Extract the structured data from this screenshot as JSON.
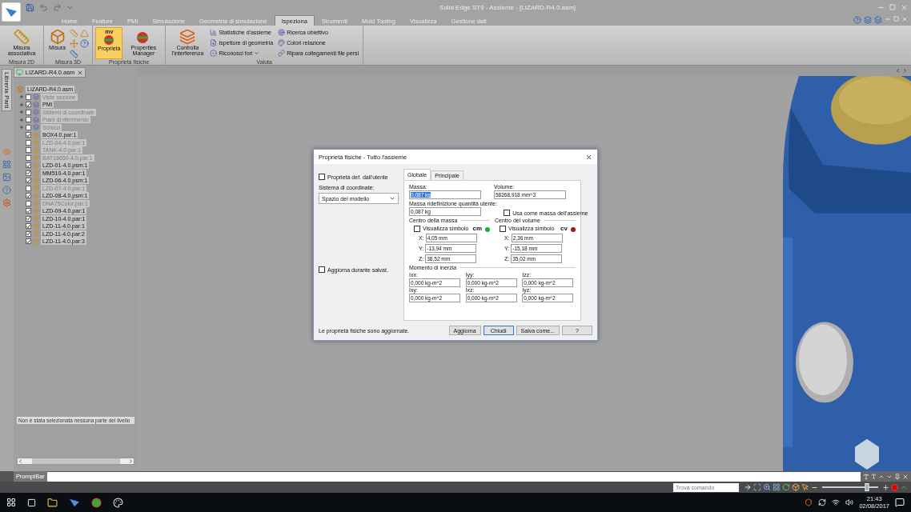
{
  "app": {
    "title": "Solid Edge ST9 - Assieme - [LIZARD-R4.0.asm]"
  },
  "ribbon_tabs": [
    {
      "label": "Home",
      "selected": false
    },
    {
      "label": "Feature",
      "selected": false
    },
    {
      "label": "PMI",
      "selected": false
    },
    {
      "label": "Simulazione",
      "selected": false
    },
    {
      "label": "Geometria di simulazione",
      "selected": false
    },
    {
      "label": "Ispeziona",
      "selected": true
    },
    {
      "label": "Strumenti",
      "selected": false
    },
    {
      "label": "Mold Tooling",
      "selected": false
    },
    {
      "label": "Visualizza",
      "selected": false
    },
    {
      "label": "Gestione dati",
      "selected": false
    }
  ],
  "ribbon_groups": [
    {
      "title": "Misura 2D",
      "items": [
        {
          "kind": "large",
          "label": "Misura associativa",
          "selected": false
        }
      ]
    },
    {
      "title": "Misura 3D",
      "items": [
        {
          "kind": "large",
          "label": "Misura",
          "selected": false
        },
        {
          "kind": "icons"
        }
      ]
    },
    {
      "title": "Proprietà fisiche",
      "items": [
        {
          "kind": "large",
          "label": "Proprietà",
          "badge": "mv",
          "selected": true
        },
        {
          "kind": "large",
          "label": "Properties Manager",
          "selected": false
        }
      ]
    },
    {
      "title": "Valuta",
      "items": [
        {
          "kind": "large",
          "label": "Controlla l'interferenza",
          "selected": false
        },
        {
          "kind": "stack",
          "entries": [
            {
              "label": "Statistiche d'assieme",
              "menu": false
            },
            {
              "label": "Ispettore di geometria",
              "menu": false
            },
            {
              "label": "Riconosci fori",
              "menu": true
            }
          ]
        },
        {
          "kind": "stack",
          "entries": [
            {
              "label": "Ricerca obiettivo",
              "menu": false
            },
            {
              "label": "Colori relazione",
              "menu": false
            },
            {
              "label": "Ripara collegamenti file persi",
              "menu": false
            }
          ]
        }
      ]
    }
  ],
  "side_tab": "Libreria Parti",
  "document_tab": "LIZARD-R4.0.asm",
  "tree": {
    "label": "LIZARD-R4.0.asm",
    "children": [
      {
        "kind": "group",
        "label": "Viste sezione",
        "checked": false,
        "expanded": false
      },
      {
        "kind": "group",
        "label": "PMI",
        "checked": true,
        "expanded": false
      },
      {
        "kind": "group",
        "label": "Sistemi di coordinate",
        "checked": false,
        "expanded": false
      },
      {
        "kind": "group",
        "label": "Piani di riferimento",
        "checked": false,
        "expanded": false
      },
      {
        "kind": "group",
        "label": "Schizzi",
        "checked": false,
        "expanded": false
      },
      {
        "kind": "part",
        "label": "BOX4.0.par:1",
        "checked": true
      },
      {
        "kind": "part",
        "label": "LZD-04-4.0.par:1",
        "checked": false
      },
      {
        "kind": "part",
        "label": "TANK-4.0.par:1",
        "checked": false
      },
      {
        "kind": "part",
        "label": "BAT18650-4.0.par:1",
        "checked": false
      },
      {
        "kind": "part",
        "label": "LZD-01-4.0.psm:1",
        "checked": true
      },
      {
        "kind": "part",
        "label": "MM510-4.0.par:1",
        "checked": true
      },
      {
        "kind": "part",
        "label": "LZD-06-4.0.psm:1",
        "checked": true
      },
      {
        "kind": "part",
        "label": "LZD-07-4.0.par:1",
        "checked": false
      },
      {
        "kind": "part",
        "label": "LZD-08-4.0.psm:1",
        "checked": true
      },
      {
        "kind": "part",
        "label": "DNA75Color.par:1",
        "checked": false
      },
      {
        "kind": "part",
        "label": "LZD-09-4.0.par:1",
        "checked": true
      },
      {
        "kind": "part",
        "label": "LZD-10-4.0.par:1",
        "checked": true
      },
      {
        "kind": "part",
        "label": "LZD-11-4.0.par:1",
        "checked": true
      },
      {
        "kind": "part",
        "label": "LZD-11-4.0.par:2",
        "checked": true
      },
      {
        "kind": "part",
        "label": "LZD-11-4.0.par:3",
        "checked": true
      }
    ]
  },
  "selection_message": "Non è stata selezionata nessuna parte del livello",
  "dialog": {
    "title": "Proprietà fisiche - Tutto l'assieme",
    "user_defined": {
      "label": "Proprietà def. dall'utente",
      "checked": false
    },
    "coord_label": "Sistema di coordinate:",
    "coord_value": "Spazio del modello",
    "update_on_save": {
      "label": "Aggiorna durante salvat.",
      "checked": false
    },
    "tabs": [
      {
        "label": "Globale",
        "selected": true
      },
      {
        "label": "Principale",
        "selected": false
      }
    ],
    "mass": {
      "label": "Massa:",
      "value": "0,087 kg",
      "selected": true
    },
    "volume": {
      "label": "Volume:",
      "value": "58268,918 mm^3"
    },
    "override": {
      "label": "Massa ridefinizione quantità utente:",
      "value": "0,087 kg"
    },
    "use_as_mass": {
      "label": "Usa come massa dell'assieme",
      "checked": false
    },
    "centers": [
      {
        "title": "Centro della massa",
        "show": {
          "label": "Visualizza simbolo",
          "checked": false
        },
        "symbol": "cm",
        "color": "#22aa33",
        "coords": [
          {
            "axis": "X:",
            "value": "4,05 mm"
          },
          {
            "axis": "Y:",
            "value": "-13,94 mm"
          },
          {
            "axis": "Z:",
            "value": "38,52 mm"
          }
        ]
      },
      {
        "title": "Centro del volume",
        "show": {
          "label": "Visualizza simbolo",
          "checked": false
        },
        "symbol": "cv",
        "color": "#aa1111",
        "coords": [
          {
            "axis": "X:",
            "value": "2,36 mm"
          },
          {
            "axis": "Y:",
            "value": "-15,18 mm"
          },
          {
            "axis": "Z:",
            "value": "35,02 mm"
          }
        ]
      }
    ],
    "inertia": {
      "title": "Momento di inerzia",
      "fields": [
        {
          "label": "Ixx:",
          "value": "0,000 kg-m^2"
        },
        {
          "label": "Iyy:",
          "value": "0,000 kg-m^2"
        },
        {
          "label": "Izz:",
          "value": "0,000 kg-m^2"
        },
        {
          "label": "Ixy:",
          "value": "0,000 kg-m^2"
        },
        {
          "label": "Ixz:",
          "value": "0,000 kg-m^2"
        },
        {
          "label": "Iyz:",
          "value": "0,000 kg-m^2"
        }
      ]
    },
    "message": "Le proprietà fisiche sono aggiornate.",
    "buttons": [
      {
        "label": "Aggiorna",
        "selected": false
      },
      {
        "label": "Chiudi",
        "selected": true
      },
      {
        "label": "Salva come...",
        "selected": false
      },
      {
        "label": "?",
        "selected": false
      }
    ]
  },
  "prompt_bar": {
    "label": "PromptBar"
  },
  "status_bar": {
    "search": {
      "placeholder": "Trova comando"
    },
    "zoom": {
      "level": 0.8
    }
  },
  "taskbar": {
    "time": "21:43",
    "date": "02/08/2017"
  }
}
